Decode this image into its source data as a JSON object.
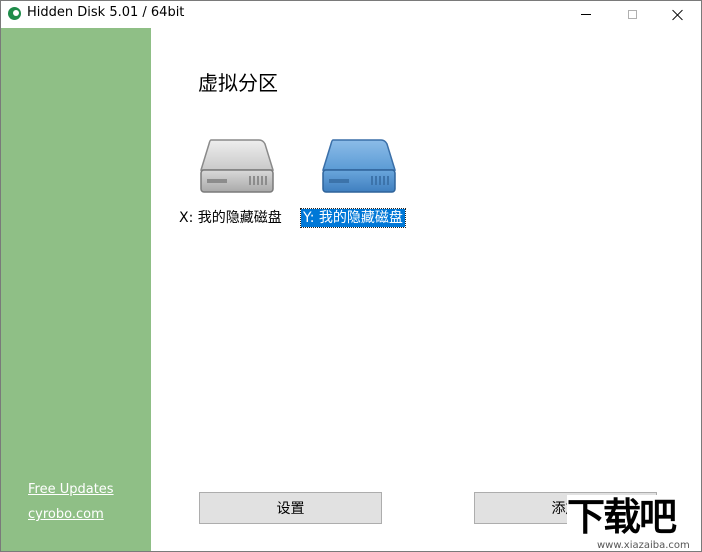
{
  "window": {
    "title": "Hidden Disk 5.01 / 64bit"
  },
  "sidebar": {
    "color": "#8fbf86",
    "links": {
      "updates": "Free Updates",
      "site": "cyrobo.com"
    }
  },
  "main": {
    "heading": "虚拟分区",
    "drives": [
      {
        "label": "X: 我的隐藏磁盘",
        "icon": "gray-drive-icon",
        "selected": false
      },
      {
        "label": "Y: 我的隐藏磁盘",
        "icon": "blue-drive-icon",
        "selected": true
      }
    ],
    "buttons": {
      "settings": "设置",
      "add": "添加"
    }
  },
  "watermark": {
    "big": "下载吧",
    "small": "www.xiazaiba.com"
  },
  "colors": {
    "selection": "#0078d7",
    "drive_blue": "#5b9bd5",
    "drive_gray": "#d6d6d6"
  }
}
